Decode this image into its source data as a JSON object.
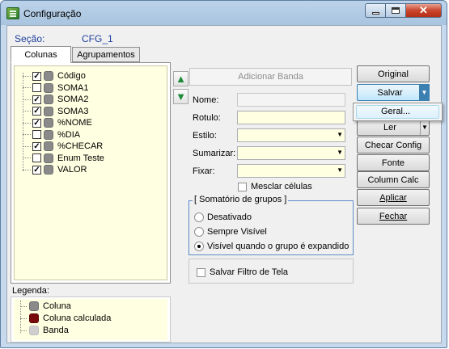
{
  "window": {
    "title": "Configuração",
    "close_glyph": "✕"
  },
  "secao": {
    "label": "Seção:",
    "value": "CFG_1"
  },
  "tabs": [
    {
      "label": "Colunas",
      "active": true
    },
    {
      "label": "Agrupamentos",
      "active": false
    }
  ],
  "tree": {
    "items": [
      {
        "label": "Código",
        "checked": true
      },
      {
        "label": "SOMA1",
        "checked": false
      },
      {
        "label": "SOMA2",
        "checked": true
      },
      {
        "label": "SOMA3",
        "checked": true
      },
      {
        "label": "%NOME",
        "checked": true
      },
      {
        "label": "%DIA",
        "checked": false
      },
      {
        "label": "%CHECAR",
        "checked": true
      },
      {
        "label": "Enum Teste",
        "checked": false
      },
      {
        "label": "VALOR",
        "checked": true
      }
    ],
    "check_glyph": "✓"
  },
  "legend": {
    "title": "Legenda:",
    "items": [
      {
        "label": "Coluna",
        "color": "#8a8a8a"
      },
      {
        "label": "Coluna calculada",
        "color": "#7a0a0a"
      },
      {
        "label": "Banda",
        "color": "#cfcfcf"
      }
    ]
  },
  "arrows": {
    "up_glyph": "▲",
    "down_glyph": "▼"
  },
  "form": {
    "add_band_label": "Adicionar Banda",
    "nome_label": "Nome:",
    "nome_value": "",
    "rotulo_label": "Rotulo:",
    "rotulo_value": "",
    "estilo_label": "Estilo:",
    "estilo_value": "",
    "sumarizar_label": "Sumarizar:",
    "sumarizar_value": "",
    "fixar_label": "Fixar:",
    "fixar_value": "",
    "mesclar_label": "Mesclar células",
    "mesclar_checked": false,
    "dropdown_glyph": "▼"
  },
  "somatorio": {
    "title": "[ Somatório de grupos ]",
    "options": [
      {
        "label": "Desativado",
        "selected": false
      },
      {
        "label": "Sempre Visível",
        "selected": false
      },
      {
        "label": "Visível quando o grupo é expandido",
        "selected": true
      }
    ]
  },
  "filtro": {
    "label": "Salvar Filtro de Tela",
    "checked": false
  },
  "side_buttons": {
    "original": "Original",
    "salvar": "Salvar",
    "ler": "Ler",
    "checar_config": "Checar Config",
    "fonte": "Fonte",
    "column_calc": "Column Calc",
    "aplicar": "Aplicar",
    "fechar": "Fechar"
  },
  "salvar_menu": {
    "items": [
      "Geral..."
    ]
  },
  "colors": {
    "accent_blue": "#1f3f9f",
    "field_yellow": "#ffffe1",
    "group_border": "#5b8bc9",
    "salvar_highlight": "#3c7fb1"
  }
}
